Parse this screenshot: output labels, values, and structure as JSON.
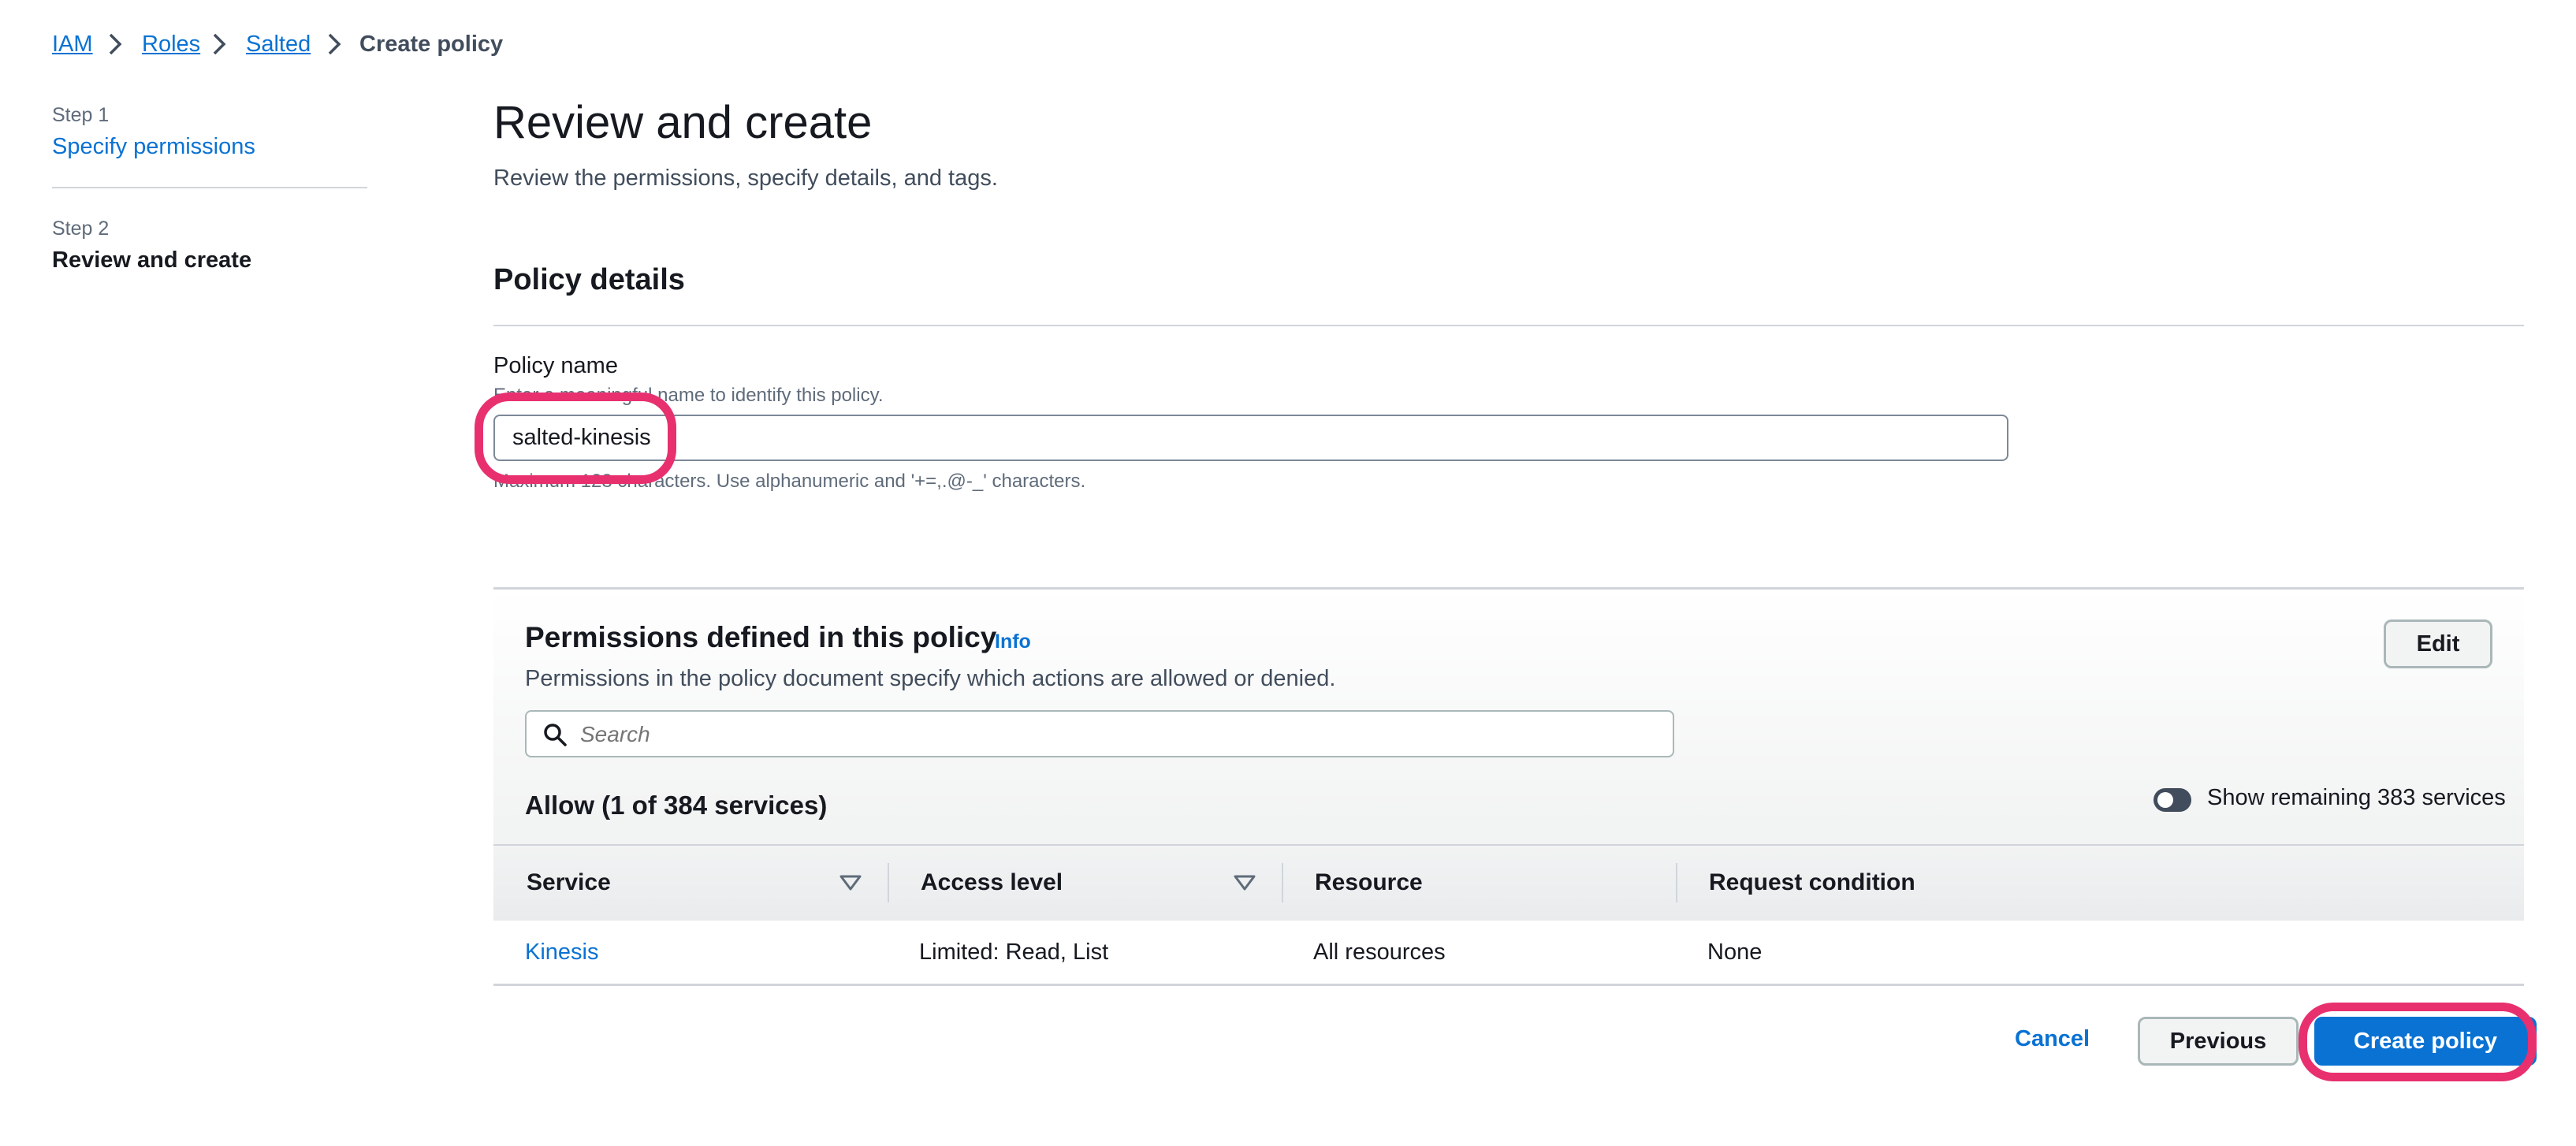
{
  "breadcrumb": {
    "items": [
      "IAM",
      "Roles",
      "Salted"
    ],
    "current": "Create policy"
  },
  "steps": [
    {
      "step": "Step 1",
      "label": "Specify permissions"
    },
    {
      "step": "Step 2",
      "label": "Review and create"
    }
  ],
  "page": {
    "title": "Review and create",
    "subtitle": "Review the permissions, specify details, and tags."
  },
  "policy_details": {
    "heading": "Policy details",
    "name_label": "Policy name",
    "name_description": "Enter a meaningful name to identify this policy.",
    "name_value": "salted-kinesis",
    "name_constraint": "Maximum 128 characters. Use alphanumeric and '+=,.@-_' characters."
  },
  "permissions": {
    "heading": "Permissions defined in this policy",
    "info_link": "Info",
    "description": "Permissions in the policy document specify which actions are allowed or denied.",
    "edit_label": "Edit",
    "search_placeholder": "Search",
    "allow_heading": "Allow (1 of 384 services)",
    "toggle_label": "Show remaining 383 services",
    "toggle_on": false,
    "columns": [
      "Service",
      "Access level",
      "Resource",
      "Request condition"
    ],
    "rows": [
      {
        "service": "Kinesis",
        "access_level": "Limited: Read, List",
        "resource": "All resources",
        "request_condition": "None"
      }
    ]
  },
  "footer": {
    "cancel_label": "Cancel",
    "previous_label": "Previous",
    "create_label": "Create policy"
  },
  "colors": {
    "link": "#0972d3",
    "primary": "#0972d3",
    "highlight": "#e8306f"
  }
}
